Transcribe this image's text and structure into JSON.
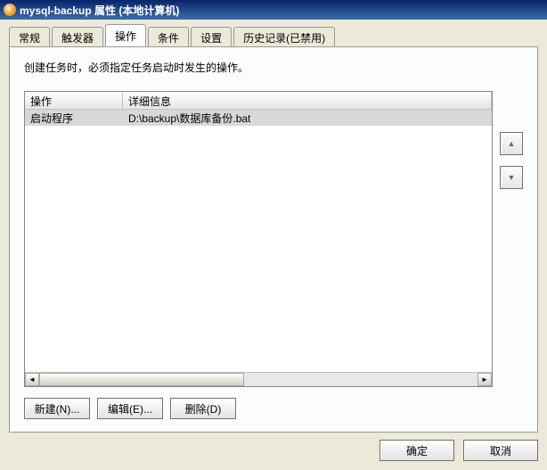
{
  "window": {
    "title": "mysql-backup 属性 (本地计算机)"
  },
  "tabs": {
    "items": [
      {
        "label": "常规"
      },
      {
        "label": "触发器"
      },
      {
        "label": "操作"
      },
      {
        "label": "条件"
      },
      {
        "label": "设置"
      },
      {
        "label": "历史记录(已禁用)"
      }
    ],
    "active_index": 2
  },
  "panel": {
    "instruction": "创建任务时，必须指定任务启动时发生的操作。",
    "columns": {
      "action": "操作",
      "detail": "详细信息"
    },
    "rows": [
      {
        "action": "启动程序",
        "detail": "D:\\backup\\数据库备份.bat",
        "selected": true
      }
    ],
    "buttons": {
      "new": "新建(N)...",
      "edit": "编辑(E)...",
      "delete": "删除(D)"
    },
    "side": {
      "up": "▲",
      "down": "▼"
    }
  },
  "dialog": {
    "ok": "确定",
    "cancel": "取消"
  }
}
